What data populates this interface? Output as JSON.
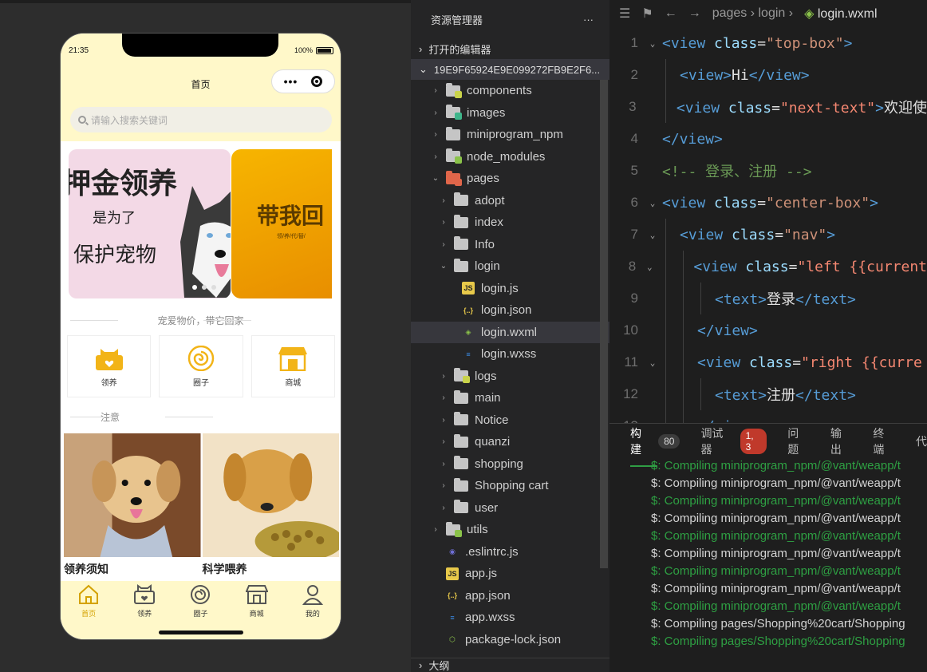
{
  "phone": {
    "status_time": "21:35",
    "battery": "100%",
    "page_title": "首页",
    "search_placeholder": "请输入搜索关键词",
    "banner1": {
      "line1": "押金领养",
      "line2": "是为了",
      "line3": "保护宠物"
    },
    "banner2": {
      "line1": "带我回",
      "line2": "领/养/代/替/"
    },
    "section1_title": "宠爱物价，带它回家",
    "cards": [
      {
        "label": "领养",
        "icon": "adopt-icon"
      },
      {
        "label": "圈子",
        "icon": "circle-icon"
      },
      {
        "label": "商城",
        "icon": "shop-icon"
      }
    ],
    "section2_title": "注意",
    "pics": [
      {
        "caption": "领养须知"
      },
      {
        "caption": "科学喂养"
      }
    ],
    "tabs": [
      {
        "label": "首页",
        "icon": "home-icon"
      },
      {
        "label": "领养",
        "icon": "adopt-icon"
      },
      {
        "label": "圈子",
        "icon": "circle-icon"
      },
      {
        "label": "商城",
        "icon": "shop-icon"
      },
      {
        "label": "我的",
        "icon": "user-icon"
      }
    ]
  },
  "explorer": {
    "title": "资源管理器",
    "more": "···",
    "open_editors": "打开的编辑器",
    "project": "19E9F65924E9E099272FB9E2F6...",
    "outline": "大纲",
    "items": [
      {
        "name": "components",
        "type": "folder",
        "level": 0,
        "chevron": "›",
        "color": "#c9d34a"
      },
      {
        "name": "images",
        "type": "folder",
        "level": 0,
        "chevron": "›",
        "color": "#3fb68b"
      },
      {
        "name": "miniprogram_npm",
        "type": "folder",
        "level": 0,
        "chevron": "›",
        "color": "#c5c5c5"
      },
      {
        "name": "node_modules",
        "type": "folder",
        "level": 0,
        "chevron": "›",
        "color": "#8bc34a"
      },
      {
        "name": "pages",
        "type": "folder-open",
        "level": 0,
        "chevron": "⌄",
        "color": "#e0664a"
      },
      {
        "name": "adopt",
        "type": "folder",
        "level": 1,
        "chevron": "›",
        "color": "#c5c5c5"
      },
      {
        "name": "index",
        "type": "folder",
        "level": 1,
        "chevron": "›",
        "color": "#c5c5c5"
      },
      {
        "name": "Info",
        "type": "folder",
        "level": 1,
        "chevron": "›",
        "color": "#c5c5c5"
      },
      {
        "name": "login",
        "type": "folder-open",
        "level": 1,
        "chevron": "⌄",
        "color": "#c5c5c5"
      },
      {
        "name": "login.js",
        "type": "js",
        "level": 2,
        "chevron": "",
        "color": "#e8c94a"
      },
      {
        "name": "login.json",
        "type": "json",
        "level": 2,
        "chevron": "",
        "color": "#e8c94a"
      },
      {
        "name": "login.wxml",
        "type": "wxml",
        "level": 2,
        "chevron": "",
        "color": "#8bc34a"
      },
      {
        "name": "login.wxss",
        "type": "wxss",
        "level": 2,
        "chevron": "",
        "color": "#3b8eea"
      },
      {
        "name": "logs",
        "type": "folder",
        "level": 1,
        "chevron": "›",
        "color": "#c9d34a"
      },
      {
        "name": "main",
        "type": "folder",
        "level": 1,
        "chevron": "›",
        "color": "#c5c5c5"
      },
      {
        "name": "Notice",
        "type": "folder",
        "level": 1,
        "chevron": "›",
        "color": "#c5c5c5"
      },
      {
        "name": "quanzi",
        "type": "folder",
        "level": 1,
        "chevron": "›",
        "color": "#c5c5c5"
      },
      {
        "name": "shopping",
        "type": "folder",
        "level": 1,
        "chevron": "›",
        "color": "#c5c5c5"
      },
      {
        "name": "Shopping cart",
        "type": "folder",
        "level": 1,
        "chevron": "›",
        "color": "#c5c5c5"
      },
      {
        "name": "user",
        "type": "folder",
        "level": 1,
        "chevron": "›",
        "color": "#c5c5c5"
      },
      {
        "name": "utils",
        "type": "folder",
        "level": 0,
        "chevron": "›",
        "color": "#8bc34a"
      },
      {
        "name": ".eslintrc.js",
        "type": "eslint",
        "level": 0,
        "chevron": "",
        "color": "#6f6fd6"
      },
      {
        "name": "app.js",
        "type": "js",
        "level": 0,
        "chevron": "",
        "color": "#e8c94a"
      },
      {
        "name": "app.json",
        "type": "json",
        "level": 0,
        "chevron": "",
        "color": "#e8c94a"
      },
      {
        "name": "app.wxss",
        "type": "wxss",
        "level": 0,
        "chevron": "",
        "color": "#3b8eea"
      },
      {
        "name": "package-lock.json",
        "type": "node",
        "level": 0,
        "chevron": "",
        "color": "#8bc34a"
      }
    ],
    "selected": "login.wxml"
  },
  "editor": {
    "breadcrumb": [
      "pages",
      "login"
    ],
    "file": "login.wxml",
    "lines": [
      {
        "n": "1",
        "fold": true,
        "html": "<span class='tg'>&lt;view</span> <span class='at'>class</span>=<span class='st'>\"top-box\"</span><span class='tg'>&gt;</span>"
      },
      {
        "n": "2",
        "fold": false,
        "indent": 1,
        "html": "<span class='tg'>&lt;view&gt;</span><span class='tx'>Hi</span><span class='tg'>&lt;/view&gt;</span>"
      },
      {
        "n": "3",
        "fold": false,
        "indent": 1,
        "html": "<span class='tg'>&lt;view</span> <span class='at'>class</span>=<span class='str2'>\"next-text\"</span><span class='tg'>&gt;</span><span class='tx'>欢迎使</span>"
      },
      {
        "n": "4",
        "fold": false,
        "html": "<span class='tg'>&lt;/view&gt;</span>"
      },
      {
        "n": "5",
        "fold": false,
        "html": "<span class='cm'>&lt;!-- 登录、注册 --&gt;</span>"
      },
      {
        "n": "6",
        "fold": true,
        "html": "<span class='tg'>&lt;view</span> <span class='at'>class</span>=<span class='st'>\"center-box\"</span><span class='tg'>&gt;</span>"
      },
      {
        "n": "7",
        "fold": true,
        "indent": 1,
        "html": "<span class='tg'>&lt;view</span> <span class='at'>class</span>=<span class='st'>\"nav\"</span><span class='tg'>&gt;</span>"
      },
      {
        "n": "8",
        "fold": true,
        "indent": 2,
        "html": "<span class='tg'>&lt;view</span> <span class='at'>class</span>=<span class='str2'>\"left {{current</span>"
      },
      {
        "n": "9",
        "fold": false,
        "indent": 3,
        "html": "<span class='tg'>&lt;text&gt;</span><span class='tx'>登录</span><span class='tg'>&lt;/text&gt;</span>"
      },
      {
        "n": "10",
        "fold": false,
        "indent": 2,
        "html": "<span class='tg'>&lt;/view&gt;</span>"
      },
      {
        "n": "11",
        "fold": true,
        "indent": 2,
        "html": "<span class='tg'>&lt;view</span> <span class='at'>class</span>=<span class='str2'>\"right {{curre</span>"
      },
      {
        "n": "12",
        "fold": false,
        "indent": 3,
        "html": "<span class='tg'>&lt;text&gt;</span><span class='tx'>注册</span><span class='tg'>&lt;/text&gt;</span>"
      },
      {
        "n": "13",
        "fold": false,
        "indent": 2,
        "html": "<span class='tg'>&lt;/view&gt;</span>"
      }
    ]
  },
  "panel": {
    "tabs": [
      {
        "label": "构建",
        "badge": "80",
        "badge_type": "grey",
        "active": true
      },
      {
        "label": "调试器",
        "badge": "1, 3",
        "badge_type": "red",
        "active": false
      },
      {
        "label": "问题",
        "badge": "",
        "active": false
      },
      {
        "label": "输出",
        "badge": "",
        "active": false
      },
      {
        "label": "终端",
        "badge": "",
        "active": false
      },
      {
        "label": "代",
        "badge": "",
        "active": false
      }
    ],
    "lines": [
      {
        "text": "$: Compiling miniprogram_npm/@vant/weapp/t",
        "green": true
      },
      {
        "text": "$: Compiling miniprogram_npm/@vant/weapp/t",
        "green": false
      },
      {
        "text": "$: Compiling miniprogram_npm/@vant/weapp/t",
        "green": true
      },
      {
        "text": "$: Compiling miniprogram_npm/@vant/weapp/t",
        "green": false
      },
      {
        "text": "$: Compiling miniprogram_npm/@vant/weapp/t",
        "green": true
      },
      {
        "text": "$: Compiling miniprogram_npm/@vant/weapp/t",
        "green": false
      },
      {
        "text": "$: Compiling miniprogram_npm/@vant/weapp/t",
        "green": true
      },
      {
        "text": "$: Compiling miniprogram_npm/@vant/weapp/t",
        "green": false
      },
      {
        "text": "$: Compiling miniprogram_npm/@vant/weapp/t",
        "green": true
      },
      {
        "text": "$: Compiling pages/Shopping%20cart/Shopping",
        "green": false
      },
      {
        "text": "$: Compiling pages/Shopping%20cart/Shopping",
        "green": true
      }
    ]
  }
}
